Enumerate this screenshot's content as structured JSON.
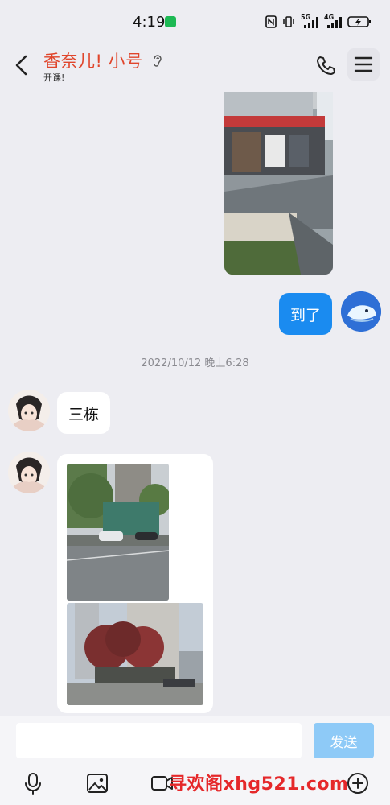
{
  "status_bar": {
    "time": "4:19",
    "net_5g": "5G",
    "net_4g": "4G"
  },
  "header": {
    "title": "香奈儿! 小号",
    "subtitle": "开课!"
  },
  "messages": {
    "me_text": "到了",
    "timestamp": "2022/10/12 晚上6:28",
    "other_text": "三栋"
  },
  "input": {
    "value": "",
    "placeholder": "",
    "send_label": "发送"
  },
  "watermark": "寻欢阁xhg521.com",
  "colors": {
    "accent": "#1A8BF0",
    "title": "#E0452B",
    "send_disabled": "#8ECAF7",
    "background": "#EDEDF2"
  },
  "icons": [
    "back-arrow-icon",
    "ear-icon",
    "phone-icon",
    "menu-icon",
    "microphone-icon",
    "image-icon",
    "video-icon",
    "add-icon"
  ]
}
